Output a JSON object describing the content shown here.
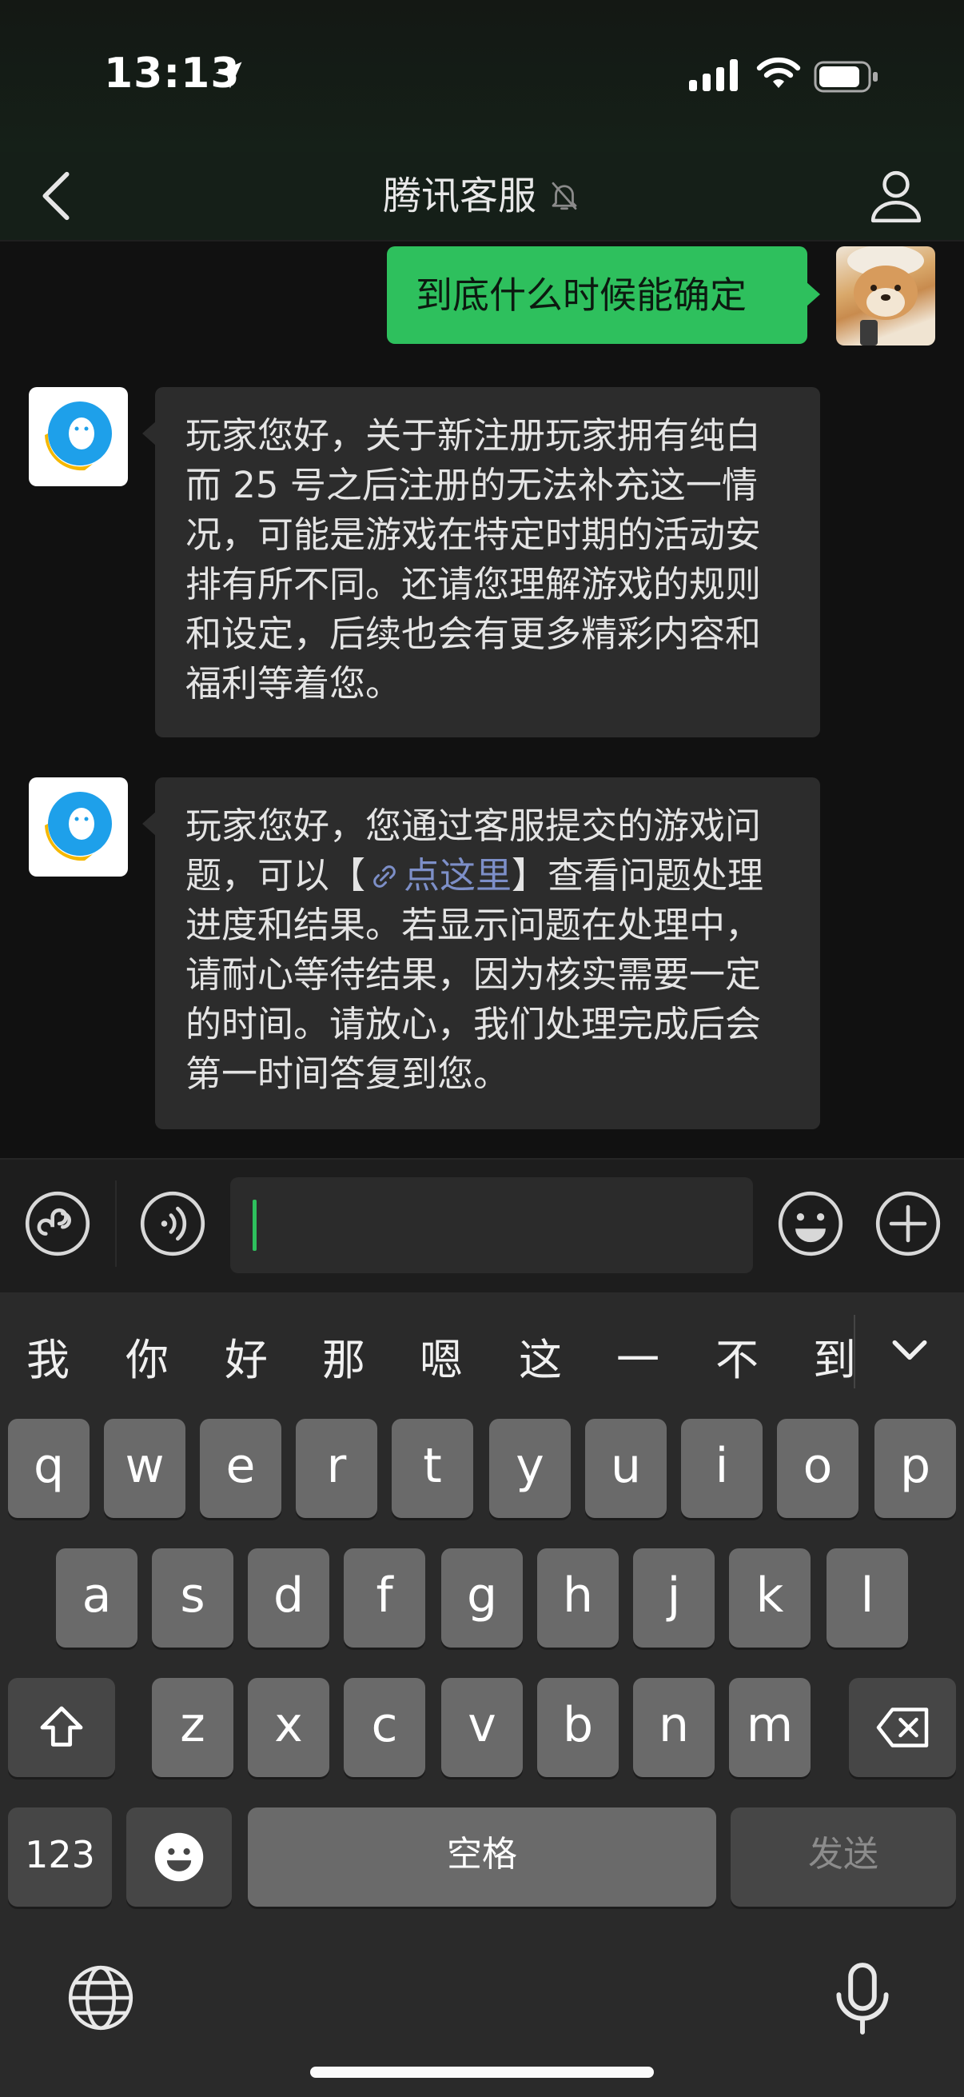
{
  "status_bar": {
    "time": "13:13"
  },
  "nav": {
    "title": "腾讯客服"
  },
  "messages": {
    "outgoing": "到底什么时候能确定",
    "incoming_1": "玩家您好，关于新注册玩家拥有纯白而 25 号之后注册的无法补充这一情况，可能是游戏在特定时期的活动安排有所不同。还请您理解游戏的规则和设定，后续也会有更多精彩内容和福利等着您。",
    "incoming_2_before": "玩家您好，您通过客服提交的游戏问题，可以【",
    "incoming_2_link": "点这里",
    "incoming_2_after": "】查看问题处理进度和结果。若显示问题在处理中，请耐心等待结果，因为核实需要一定的时间。请放心，我们处理完成后会第一时间答复到您。"
  },
  "input": {
    "value": ""
  },
  "keyboard": {
    "candidates": [
      "我",
      "你",
      "好",
      "那",
      "嗯",
      "这",
      "一",
      "不",
      "到"
    ],
    "row1": [
      "q",
      "w",
      "e",
      "r",
      "t",
      "y",
      "u",
      "i",
      "o",
      "p"
    ],
    "row2": [
      "a",
      "s",
      "d",
      "f",
      "g",
      "h",
      "j",
      "k",
      "l"
    ],
    "row3": [
      "z",
      "x",
      "c",
      "v",
      "b",
      "n",
      "m"
    ],
    "numbers_label": "123",
    "space_label": "空格",
    "send_label": "发送"
  },
  "colors": {
    "accent_green": "#2ec05d",
    "link_blue": "#7d8fc8",
    "background": "#111111"
  },
  "icons": [
    "location-arrow-icon",
    "signal-icon",
    "wifi-icon",
    "battery-icon",
    "back-chevron-icon",
    "mute-bell-icon",
    "profile-icon",
    "mini-program-icon",
    "voice-icon",
    "emoji-icon",
    "plus-icon",
    "shift-icon",
    "backspace-icon",
    "globe-icon",
    "microphone-icon"
  ]
}
